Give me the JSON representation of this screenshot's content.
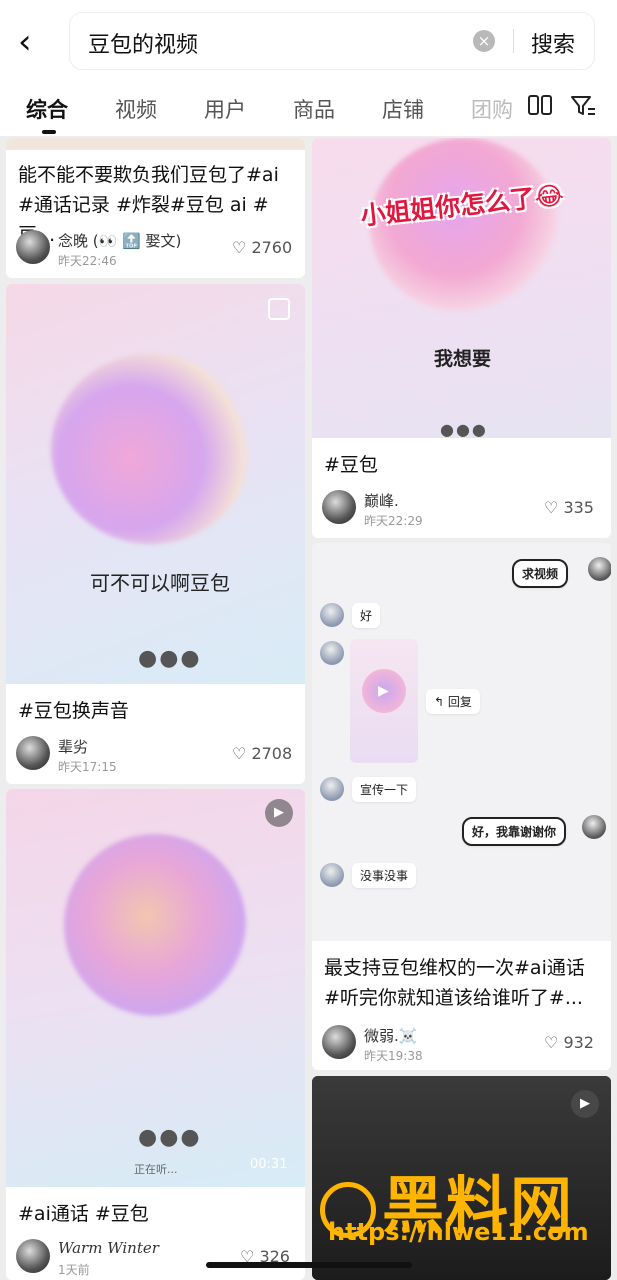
{
  "search": {
    "query": "豆包的视频",
    "submit": "搜索"
  },
  "tabs": [
    {
      "label": "综合"
    },
    {
      "label": "视频"
    },
    {
      "label": "用户"
    },
    {
      "label": "商品"
    },
    {
      "label": "店铺"
    },
    {
      "label": "团购"
    }
  ],
  "icons": {
    "back": "back-arrow-icon",
    "clear": "clear-icon",
    "layout": "layout-toggle-icon",
    "filter": "filter-icon",
    "like": "heart-icon"
  },
  "left": [
    {
      "title_l1": "能不能不要欺负我们豆包了#ai",
      "title_l2": "#通话记录 #炸裂#豆包 ai #豆...",
      "user": "念晚 (👀 🔝 娶文)",
      "time": "昨天22:46",
      "likes": "2760"
    },
    {
      "caption": "可不可以啊豆包",
      "title_l1": "#豆包换声音",
      "user": "辈劣",
      "time": "昨天17:15",
      "likes": "2708"
    },
    {
      "status": "正在听...",
      "duration": "00:31",
      "title_l1": "#ai通话 #豆包",
      "user": "Warm Winter",
      "time": "1天前",
      "likes": "326"
    }
  ],
  "right": [
    {
      "overlay": "小姐姐你怎么了😂",
      "caption": "我想要",
      "title_l1": "#豆包",
      "user": "巅峰.",
      "time": "昨天22:29",
      "likes": "335"
    },
    {
      "chat": {
        "request": "求视频",
        "reply1": "好",
        "reply_btn": "回复",
        "reply2": "宣传一下",
        "thanks": "好，我靠谢谢你",
        "reply3": "没事没事"
      },
      "title_l1": "最支持豆包维权的一次#ai通话",
      "title_l2": "#听完你就知道该给谁听了#...",
      "user": "微弱.☠️",
      "time": "昨天19:38",
      "likes": "932"
    }
  ],
  "watermark": {
    "brand": "黑料网",
    "url": "https://hlwe11.com"
  },
  "colors": {
    "accent_watermark": "#ffb400",
    "overlay_text": "#e2173f"
  }
}
